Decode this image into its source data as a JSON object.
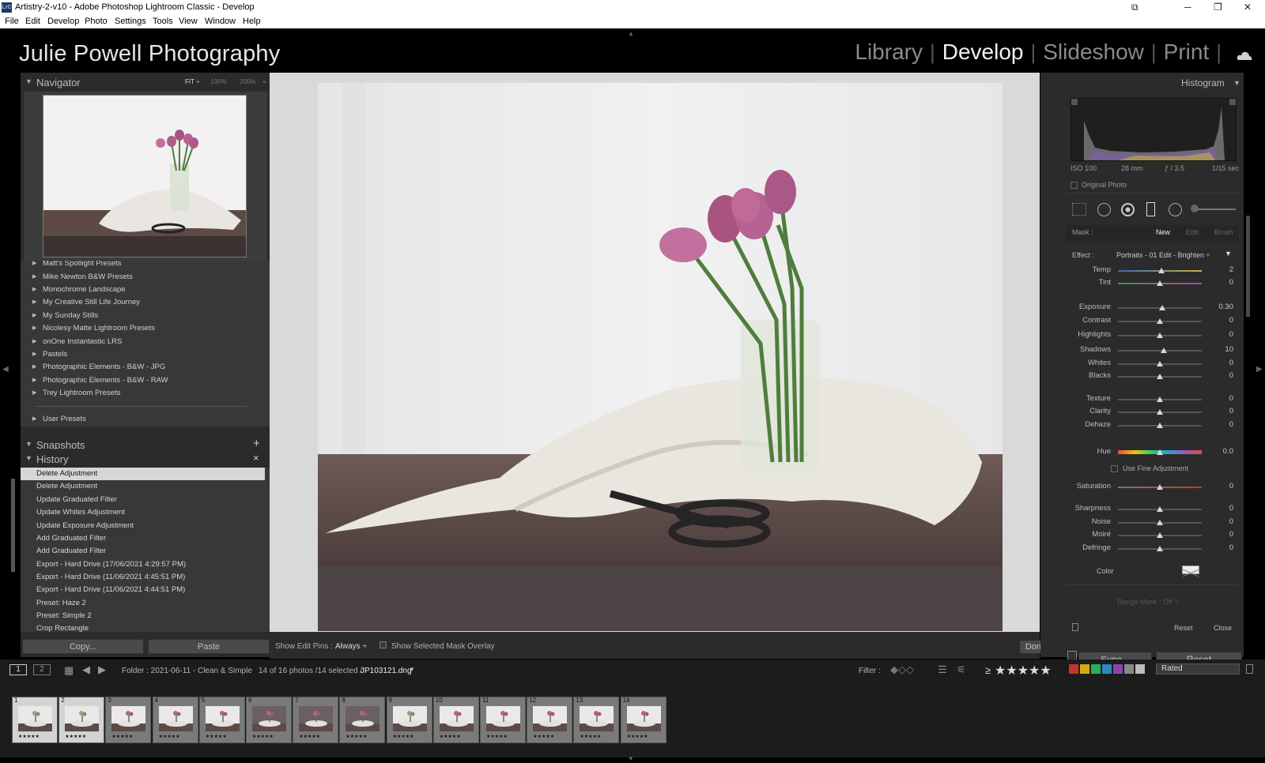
{
  "window": {
    "title": "Artistry-2-v10 - Adobe Photoshop Lightroom Classic - Develop",
    "app_badge": "LrC"
  },
  "menu": [
    "File",
    "Edit",
    "Develop",
    "Photo",
    "Settings",
    "Tools",
    "View",
    "Window",
    "Help"
  ],
  "identity_plate": "Julie Powell Photography",
  "modules": [
    "Library",
    "Develop",
    "Slideshow",
    "Print"
  ],
  "active_module": "Develop",
  "navigator": {
    "title": "Navigator",
    "zoom": [
      "FIT ÷",
      "100%",
      "200%",
      "÷"
    ]
  },
  "presets": [
    "Matt's Spotlight Presets",
    "Mike Newton B&W Presets",
    "Monochrome Landscape",
    "My Creative Still Life Journey",
    "My Sunday Stills",
    "Nicolesy Matte Lightroom Presets",
    "onOne Instantastic LRS",
    "Pastels",
    "Photographic Elements - B&W - JPG",
    "Photographic Elements - B&W - RAW",
    "Trey Lightroom Presets",
    "User Presets"
  ],
  "snapshots": {
    "title": "Snapshots",
    "add": "+"
  },
  "history": {
    "title": "History",
    "close": "×",
    "items": [
      "Delete Adjustment",
      "Delete Adjustment",
      "Update Graduated Filter",
      "Update Whites Adjustment",
      "Update Exposure Adjustment",
      "Add Graduated Filter",
      "Add Graduated Filter",
      "Export - Hard Drive (17/06/2021 4:29:57 PM)",
      "Export - Hard Drive (11/06/2021 4:45:51 PM)",
      "Export - Hard Drive (11/06/2021 4:44:51 PM)",
      "Preset: Haze 2",
      "Preset: Simple 2",
      "Crop Rectangle"
    ]
  },
  "left_buttons": {
    "copy": "Copy...",
    "paste": "Paste"
  },
  "toolbar": {
    "show_edit_pins": "Show Edit Pins :",
    "edit_pins_value": "Always ÷",
    "mask_overlay": "Show Selected Mask Overlay",
    "done": "Done"
  },
  "histogram": {
    "title": "Histogram",
    "iso": "ISO 100",
    "focal": "28 mm",
    "aperture": "ƒ / 3.5",
    "shutter": "1/15 sec",
    "original_photo": "Original Photo"
  },
  "mask": {
    "label": "Mask :",
    "new": "New",
    "edit": "Edit",
    "brush": "Brush"
  },
  "effect": {
    "label": "Effect :",
    "value": "Portraits - 01 Edit - Brighten ÷"
  },
  "sliders": [
    {
      "label": "Temp",
      "value": "2",
      "pos": 0.52
    },
    {
      "label": "Tint",
      "value": "0",
      "pos": 0.5
    },
    {
      "label": "Exposure",
      "value": "0.30",
      "pos": 0.53
    },
    {
      "label": "Contrast",
      "value": "0",
      "pos": 0.5
    },
    {
      "label": "Highlights",
      "value": "0",
      "pos": 0.5
    },
    {
      "label": "Shadows",
      "value": "10",
      "pos": 0.55
    },
    {
      "label": "Whites",
      "value": "0",
      "pos": 0.5
    },
    {
      "label": "Blacks",
      "value": "0",
      "pos": 0.5
    },
    {
      "label": "Texture",
      "value": "0",
      "pos": 0.5
    },
    {
      "label": "Clarity",
      "value": "0",
      "pos": 0.5
    },
    {
      "label": "Dehaze",
      "value": "0",
      "pos": 0.5
    },
    {
      "label": "Hue",
      "value": "0.0",
      "pos": 0.5
    },
    {
      "label": "Saturation",
      "value": "0",
      "pos": 0.5
    },
    {
      "label": "Sharpness",
      "value": "0",
      "pos": 0.5
    },
    {
      "label": "Noise",
      "value": "0",
      "pos": 0.5
    },
    {
      "label": "Moiré",
      "value": "0",
      "pos": 0.5
    },
    {
      "label": "Defringe",
      "value": "0",
      "pos": 0.5
    }
  ],
  "fine_adjust": "Use Fine Adjustment",
  "color_label": "Color",
  "range_mask": "Range Mask : Off ÷",
  "mask_buttons": {
    "reset": "Reset",
    "close": "Close"
  },
  "right_buttons": {
    "sync": "Sync...",
    "reset": "Reset"
  },
  "filmstrip_bar": {
    "views": [
      "1",
      "2"
    ],
    "folder": "Folder : 2021-06-11 - Clean & Simple",
    "count": "14 of 16 photos /14 selected /",
    "filename": "JP103121.dng",
    "filter_label": "Filter :",
    "rating_op": "≥",
    "rating_stars": "★★★★★",
    "rated": "Rated"
  },
  "film_colors": [
    "#c0392b",
    "#d4ac0d",
    "#27ae60",
    "#2e86c1",
    "#8e44ad",
    "#888888",
    "#bbbbbb"
  ],
  "thumbs": [
    {
      "num": "1",
      "stars": "★★★★★"
    },
    {
      "num": "2",
      "stars": "★★★★★"
    },
    {
      "num": "3",
      "stars": "★★★★★"
    },
    {
      "num": "4",
      "stars": "★★★★★"
    },
    {
      "num": "5",
      "stars": "★★★★★"
    },
    {
      "num": "6",
      "stars": "★★★★★"
    },
    {
      "num": "7",
      "stars": "★★★★★"
    },
    {
      "num": "8",
      "stars": "★★★★★"
    },
    {
      "num": "9",
      "stars": "★★★★★"
    },
    {
      "num": "10",
      "stars": "★★★★★"
    },
    {
      "num": "11",
      "stars": "★★★★★"
    },
    {
      "num": "12",
      "stars": "★★★★★"
    },
    {
      "num": "13",
      "stars": "★★★★★"
    },
    {
      "num": "14",
      "stars": "★★★★★"
    }
  ]
}
